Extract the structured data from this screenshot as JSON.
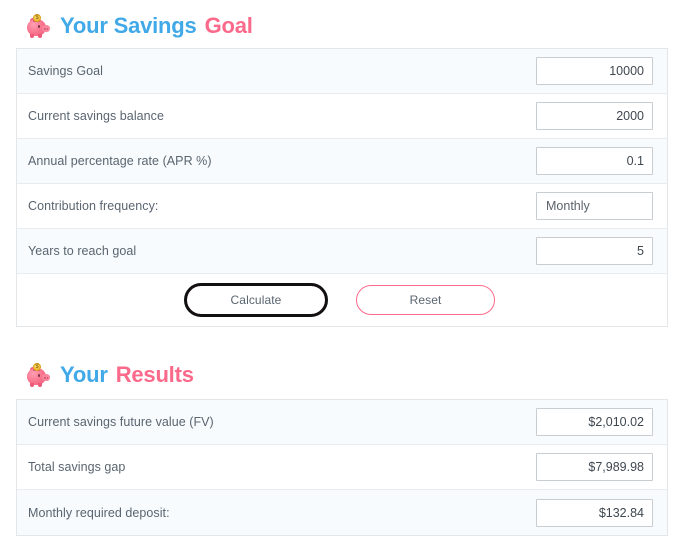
{
  "goal_section": {
    "icon": "piggy-bank-icon",
    "title_primary": "Your Savings",
    "title_accent": "Goal",
    "rows": [
      {
        "label": "Savings Goal",
        "value": "10000",
        "type": "number"
      },
      {
        "label": "Current savings balance",
        "value": "2000",
        "type": "number"
      },
      {
        "label": "Annual percentage rate (APR %)",
        "value": "0.1",
        "type": "number"
      },
      {
        "label": "Contribution frequency:",
        "value": "Monthly",
        "type": "select"
      },
      {
        "label": "Years to reach goal",
        "value": "5",
        "type": "number"
      }
    ],
    "buttons": {
      "calculate_label": "Calculate",
      "reset_label": "Reset"
    }
  },
  "results_section": {
    "icon": "piggy-bank-icon",
    "title_primary": "Your",
    "title_accent": "Results",
    "rows": [
      {
        "label": "Current savings future value (FV)",
        "value": "$2,010.02"
      },
      {
        "label": "Total savings gap",
        "value": "$7,989.98"
      },
      {
        "label": "Monthly required deposit:",
        "value": "$132.84"
      }
    ]
  },
  "colors": {
    "accent_blue": "#41a9e8",
    "accent_pink": "#fb6a8a",
    "row_shaded": "#f7fbfd",
    "border": "#e4e7ea",
    "label_text": "#5a6570",
    "focus_ring": "#111111"
  }
}
